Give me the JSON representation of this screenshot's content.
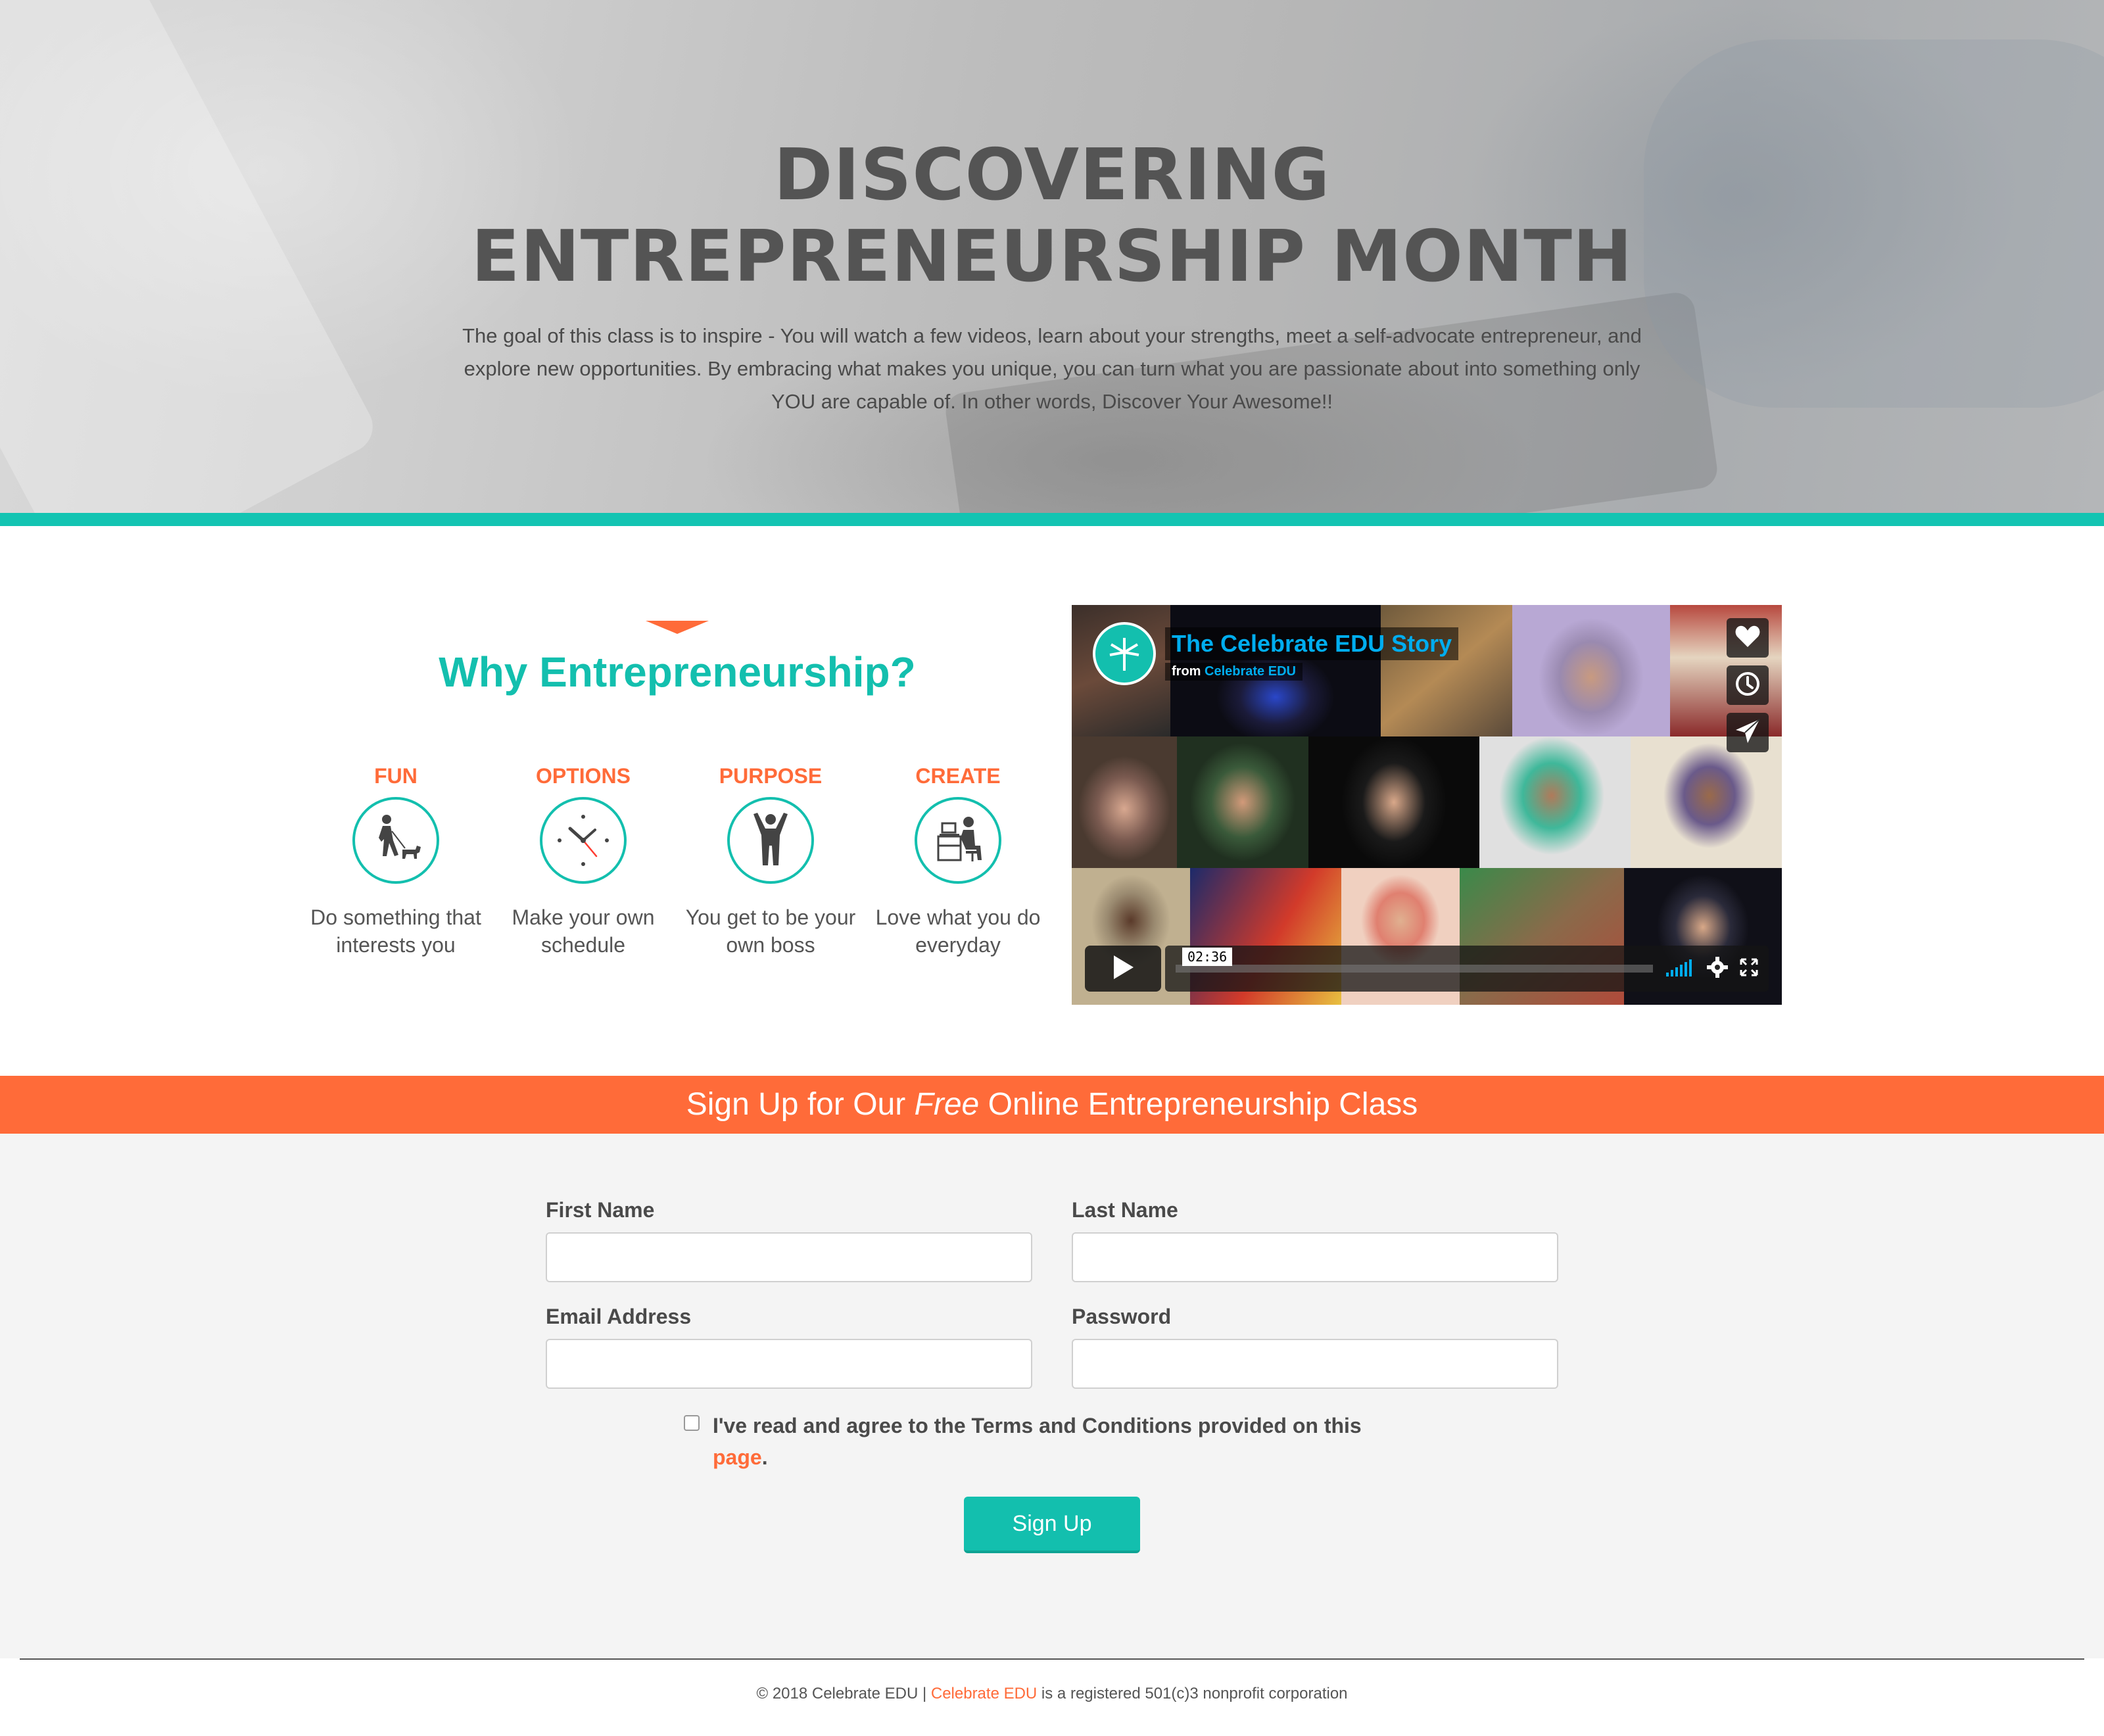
{
  "hero": {
    "title_line1": "DISCOVERING",
    "title_line2": "ENTREPRENEURSHIP MONTH",
    "description": "The goal of this class is to inspire - You will watch a few videos, learn about your strengths, meet a self-advocate entrepreneur, and explore new opportunities. By embracing what makes you unique, you can turn what you are passionate about into something only YOU are capable of. In other words, Discover Your Awesome!!"
  },
  "why": {
    "title": "Why Entrepreneurship?",
    "features": [
      {
        "label": "FUN",
        "text": "Do something that interests you",
        "icon": "person-walking-dog-icon"
      },
      {
        "label": "OPTIONS",
        "text": "Make your own schedule",
        "icon": "clock-icon"
      },
      {
        "label": "PURPOSE",
        "text": "You get to be your own boss",
        "icon": "person-arms-raised-icon"
      },
      {
        "label": "CREATE",
        "text": "Love what you do everyday",
        "icon": "person-at-desk-icon"
      }
    ]
  },
  "video": {
    "title": "The Celebrate EDU Story",
    "from_prefix": "from",
    "from_channel": "Celebrate EDU",
    "duration": "02:36",
    "buttons": [
      "heart-icon",
      "clock-icon",
      "send-icon"
    ],
    "controls": [
      "play-icon",
      "volume-icon",
      "settings-icon",
      "fullscreen-icon"
    ]
  },
  "signup": {
    "banner_pre": "Sign Up for Our ",
    "banner_em": "Free",
    "banner_post": " Online Entrepreneurship Class",
    "first_name_label": "First Name",
    "last_name_label": "Last Name",
    "email_label": "Email Address",
    "password_label": "Password",
    "first_name_value": "",
    "last_name_value": "",
    "email_value": "",
    "password_value": "",
    "terms_text": "I've read and agree to the Terms and Conditions provided on this ",
    "terms_link": "page",
    "terms_end": ".",
    "button_label": "Sign Up"
  },
  "footer": {
    "prefix": "© 2018 Celebrate EDU | ",
    "brand": "Celebrate EDU",
    "suffix": " is a registered 501(c)3 nonprofit corporation"
  },
  "colors": {
    "teal": "#13bfae",
    "orange": "#ff6b39",
    "video_blue": "#00adef"
  }
}
